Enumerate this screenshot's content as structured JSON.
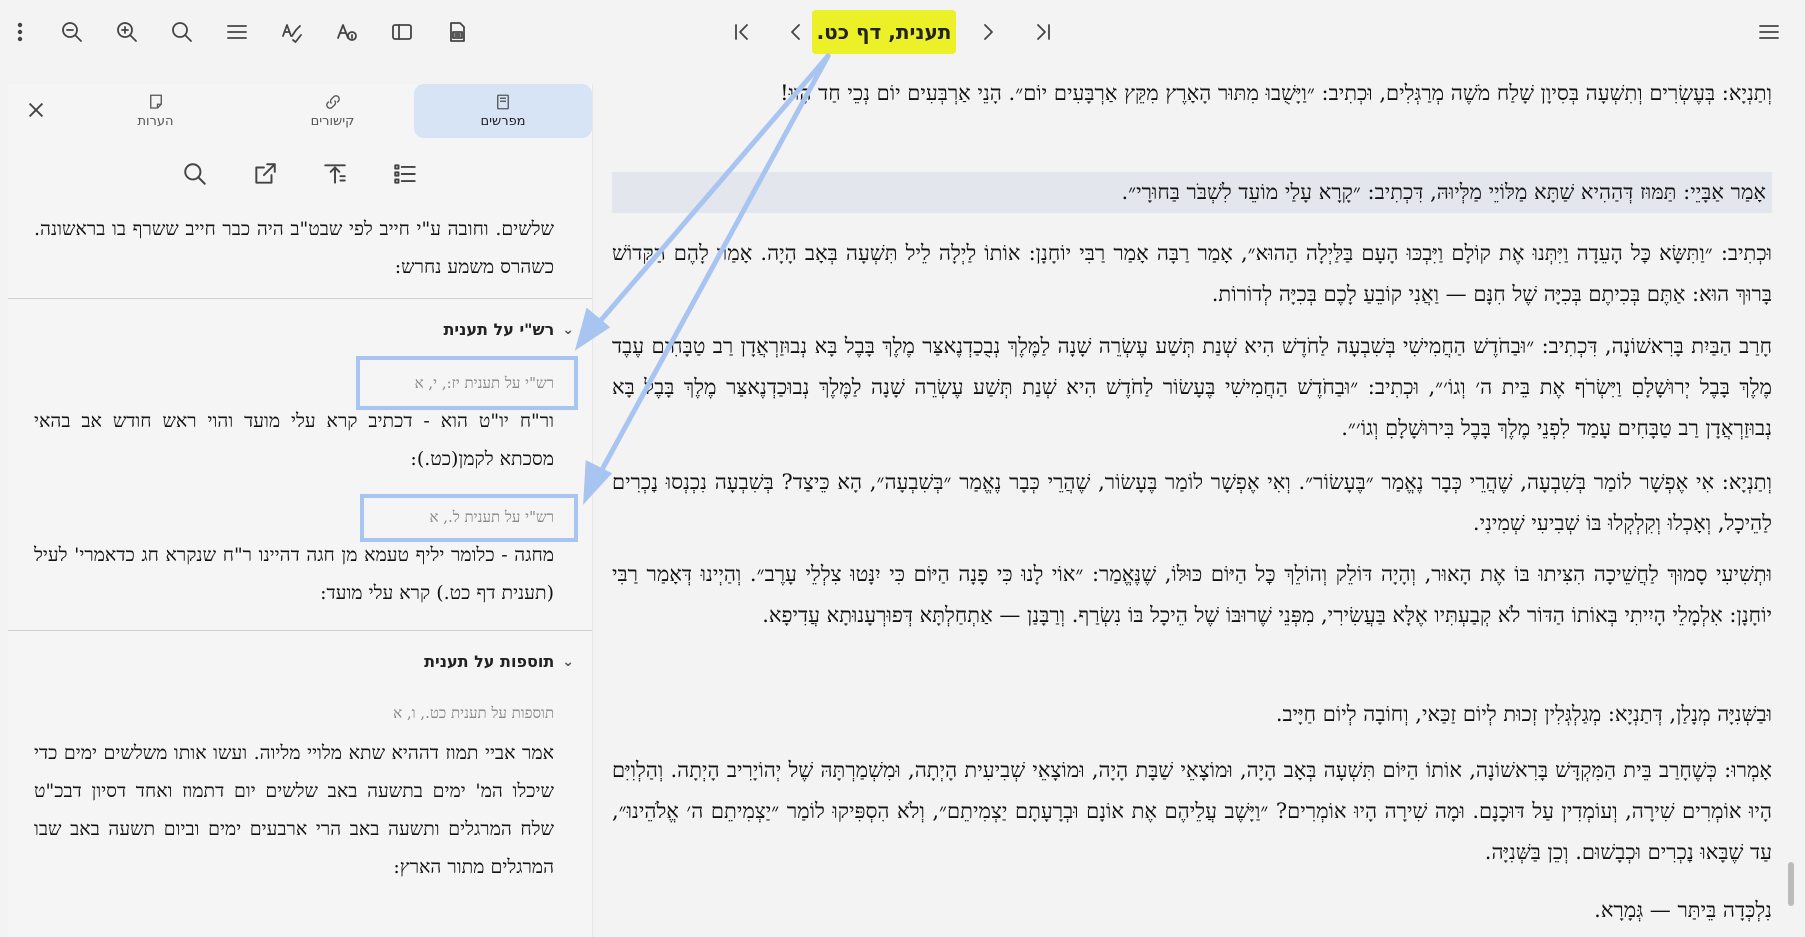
{
  "toolbar": {
    "title": "תענית, דף כט.",
    "icons": [
      "more-vert-icon",
      "zoom-out-icon",
      "zoom-in-icon",
      "search-icon",
      "menu-lines-icon",
      "spellcheck-icon",
      "font-info-icon",
      "sidebar-icon",
      "print-icon",
      "first-page-icon",
      "prev-page-icon",
      "next-page-icon",
      "last-page-icon",
      "hamburger-icon"
    ]
  },
  "panel": {
    "tabs": [
      {
        "label": "מפרשים",
        "active": true
      },
      {
        "label": "קישורים",
        "active": false
      },
      {
        "label": "הערות",
        "active": false
      }
    ],
    "top_text": "שלשים. וחובה ע\"י חייב לפי שבט\"ב היה כבר חייב ששרף בו בראשונה. כשהרס משמע נחרש:",
    "sections": [
      {
        "title": "רש\"י על תענית",
        "entries": [
          {
            "ref": "רש\"י על תענית יז:, י, א",
            "text": "ור\"ח יו\"ט הוא - דכתיב קרא עלי מועד והוי ראש חודש אב בהאי מסכתא לקמן(כט.):"
          },
          {
            "ref": "רש\"י על תענית ל., א",
            "text": "מחגה - כלומר יליף טעמא מן חגה דהיינו ר\"ח שנקרא חג כדאמרי' לעיל (תענית דף כט.) קרא עלי מועד:"
          }
        ]
      },
      {
        "title": "תוספות על תענית",
        "entries": [
          {
            "ref": "תוספות על תענית כט., ו, א",
            "text": "אמר אביי תמוז דההיא שתא מלויי מליוה. ועשו אותו משלשים ימים כדי שיכלו המ' ימים בתשעה באב שלשים יום דתמוז ואחד דסיון דבכ\"ט שלח המרגלים ותשעה באב הרי ארבעים ימים וביום תשעה באב שבו המרגלים מתור הארץ:"
          }
        ]
      }
    ]
  },
  "main": {
    "paragraphs": [
      "וְתַנְיָא: בְּעֶשְׂרִים וְתִשְׁעָה בְּסִיוָן שָׁלַח מֹשֶׁה מְרַגְּלִים, וּכְתִיב: ״וַיָּשֻׁבוּ מִתּוּר הָאָרֶץ מִקֵּץ אַרְבָּעִים יוֹם״. הָנֵי אַרְבְּעִים יוֹם נְכֵי חַד הָווּ!",
      "אָמַר אַבָּיֵי: תַּמּוּז דְּהַהִיא שַׁתָּא מַלּוֹיֵי מַלְּיוּהּ, דִּכְתִיב: ״קָרָא עָלַי מוֹעֵד לִשְׁבֹּר בַּחוּרָי״.",
      "וּכְתִיב: ״וַתִּשָּׂא כׇּל הָעֵדָה וַיִּתְּנוּ אֶת קוֹלָם וַיִּבְכּוּ הָעָם בַּלַּיְלָה הַהוּא״, אָמַר רַבָּה אָמַר רַבִּי יוֹחָנָן: אוֹתוֹ לַיְלָה לֵיל תִּשְׁעָה בְּאָב הָיָה. אָמַר לָהֶם הַקָּדוֹשׁ בָּרוּךְ הוּא: אַתֶּם בְּכִיתֶם בְּכִיָּה שֶׁל חִנָּם — וַאֲנִי קוֹבֵעַ לָכֶם בְּכִיָּה לְדוֹרוֹת.",
      "חָרַב הַבַּיִת בָּרִאשׁוֹנָה, דִּכְתִיב: ״וּבַחֹדֶשׁ הַחֲמִישִׁי בְּשִׁבְעָה לַחֹדֶשׁ הִיא שְׁנַת תְּשַׁע עֶשְׂרֵה שָׁנָה לַמֶּלֶךְ נְבֻכַדְנֶאצַּר מֶלֶךְ בָּבֶל בָּא נְבוּזַרְאֲדָן רַב טַבָּחִים עֶבֶד מֶלֶךְ בָּבֶל יְרוּשָׁלָםִ וַיִּשְׂרֹף אֶת בֵּית ה׳ וְגוֹ׳״, וּכְתִיב: ״וּבַחֹדֶשׁ הַחֲמִישִׁי בֶּעָשׂוֹר לַחֹדֶשׁ הִיא שְׁנַת תְּשַׁע עֶשְׂרֵה שָׁנָה לַמֶּלֶךְ נְבוּכַדְנֶאצַּר מֶלֶךְ בָּבֶל בָּא נְבוּזַרְאֲדָן רַב טַבָּחִים עָמַד לִפְנֵי מֶלֶךְ בָּבֶל בִּירוּשָׁלָםִ וְגוֹ׳״.",
      "וְתַנְיָא: אִי אֶפְשָׁר לוֹמַר בְּשִׁבְעָה, שֶׁהֲרֵי כְּבָר נֶאֱמַר ״בֶּעָשׂוֹר״. וְאִי אֶפְשָׁר לוֹמַר בֶּעָשׂוֹר, שֶׁהֲרֵי כְּבָר נֶאֱמַר ״בְּשִׁבְעָה״, הָא כֵּיצַד? בְּשִׁבְעָה נִכְנְסוּ נׇכְרִים לַהֵיכָל, וְאָכְלוּ וְקִלְקְלוּ בּוֹ שְׁבִיעִי שְׁמִינִי.",
      "וּתְשִׁיעִי סָמוּךְ לַחֲשֵׁיכָה הִצִּיתוּ בּוֹ אֶת הָאוּר, וְהָיָה דּוֹלֵק וְהוֹלֵךְ כׇּל הַיּוֹם כּוּלּוֹ, שֶׁנֶּאֱמַר: ״אוֹי לָנוּ כִּי פָנָה הַיּוֹם כִּי יִנָּטוּ צִלְלֵי עָרֶב״. וְהַיְינוּ דְּאָמַר רַבִּי יוֹחָנָן: אִלְמָלֵי הָיִיתִי בְּאוֹתוֹ הַדּוֹר לֹא קְבַעְתִּיו אֶלָּא בַּעֲשִׂירִי, מִפְּנֵי שֶׁרוּבּוֹ שֶׁל הֵיכָל בּוֹ נִשְׂרַף. וְרַבָּנַן — אַתְחַלְתָּא דְּפוּרְעָנוּתָא עֲדִיפָא.",
      "וּבַשְּׁנִיָּה מְנָלַן, דְּתַנְיָא: מְגַלְגְּלִין זְכוּת לְיוֹם זַכַּאי, וְחוֹבָה לְיוֹם חַיָּיב.",
      "אָמְרוּ: כְּשֶׁחָרַב בֵּית הַמִּקְדָּשׁ בָּרִאשׁוֹנָה, אוֹתוֹ הַיּוֹם תִּשְׁעָה בְּאָב הָיָה, וּמוֹצָאֵי שַׁבָּת הָיָה, וּמוֹצָאֵי שְׁבִיעִית הָיְתָה, וּמִשְׁמַרְתָּהּ שֶׁל יְהוֹיָרִיב הָיְתָה. וְהַלְוִיִּם הָיוּ אוֹמְרִים שִׁירָה, וְעוֹמְדִין עַל דּוּכָנָם. וּמָה שִׁירָה הָיוּ אוֹמְרִים? ״וַיָּשֶׁב עֲלֵיהֶם אֶת אוֹנָם וּבְרָעָתָם יַצְמִיתֵם״, וְלֹא הִסְפִּיקוּ לוֹמַר ״יַצְמִיתֵם ה׳ אֱלֹהֵינוּ״, עַד שֶׁבָּאוּ נׇכְרִים וּכְבָשׁוּם. וְכֵן בַּשְּׁנִיָּה.",
      "נִלְכְּדָה בֵּיתַּר — גְּמָרָא."
    ]
  },
  "colors": {
    "title_highlight": "#ecf026",
    "annotation_blue": "#a8c4f0",
    "active_tab": "#d6e4f6",
    "highlight_row": "#e3e6ec"
  }
}
